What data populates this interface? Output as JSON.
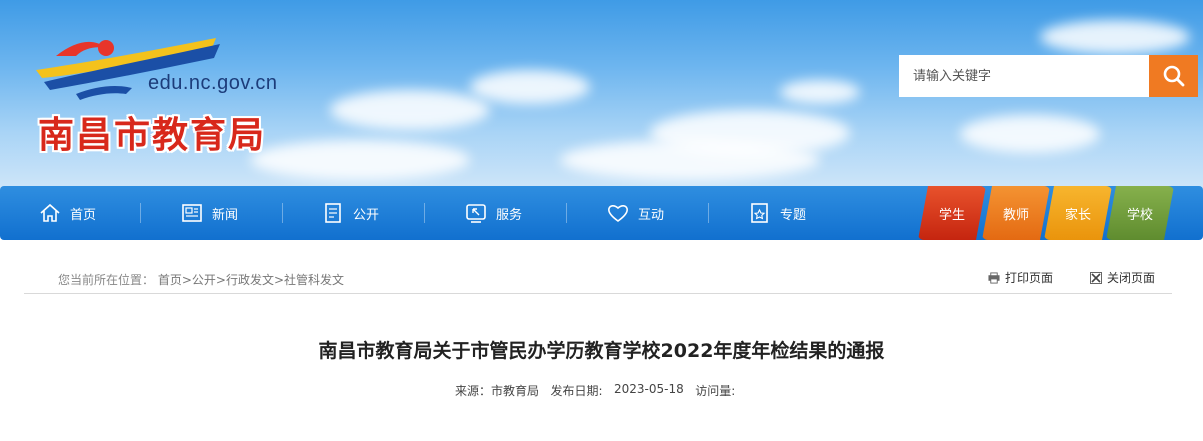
{
  "header": {
    "site_url": "edu.nc.gov.cn",
    "site_name": "南昌市教育局",
    "search_placeholder": "请输入关键字"
  },
  "nav": {
    "items": [
      {
        "label": "首页",
        "icon": "home-icon"
      },
      {
        "label": "新闻",
        "icon": "news-icon"
      },
      {
        "label": "公开",
        "icon": "document-icon"
      },
      {
        "label": "服务",
        "icon": "service-icon"
      },
      {
        "label": "互动",
        "icon": "heart-icon"
      },
      {
        "label": "专题",
        "icon": "star-doc-icon"
      }
    ],
    "roles": [
      {
        "label": "学生",
        "color": "#d9351c"
      },
      {
        "label": "教师",
        "color": "#ef7a1e"
      },
      {
        "label": "家长",
        "color": "#f2a51a"
      },
      {
        "label": "学校",
        "color": "#6d9a3a"
      }
    ]
  },
  "breadcrumb": {
    "prefix": "您当前所在位置：",
    "path": "首页>公开>行政发文>社管科发文"
  },
  "tools": {
    "print": "打印页面",
    "close": "关闭页面"
  },
  "article": {
    "title": "南昌市教育局关于市管民办学历教育学校2022年度年检结果的通报",
    "source_label": "来源：",
    "source": "市教育局",
    "date_label": "发布日期:",
    "date": "2023-05-18",
    "visits_label": "访问量:"
  },
  "colors": {
    "nav_blue": "#1170cf",
    "search_orange": "#f07a22",
    "site_name_red": "#d8281b"
  }
}
